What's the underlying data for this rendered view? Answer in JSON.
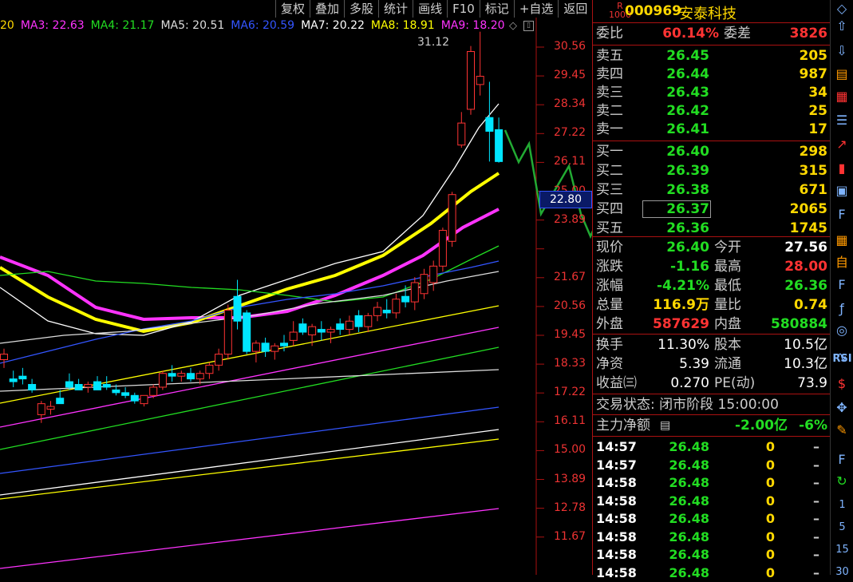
{
  "toolbar": [
    "复权",
    "叠加",
    "多股",
    "统计",
    "画线",
    "F10",
    "标记",
    "+自选",
    "返回"
  ],
  "ma_legend": [
    {
      "text": "20",
      "color": "#ffd800"
    },
    {
      "text": "MA3: 22.63",
      "color": "#ff33ff"
    },
    {
      "text": "MA4: 21.17",
      "color": "#22dd22"
    },
    {
      "text": "MA5: 20.51",
      "color": "#dddddd"
    },
    {
      "text": "MA6: 20.59",
      "color": "#3355ff"
    },
    {
      "text": "MA7: 20.22",
      "color": "#ffffff"
    },
    {
      "text": "MA8: 18.91",
      "color": "#ffff00"
    },
    {
      "text": "MA9: 18.20",
      "color": "#ff33ff"
    }
  ],
  "chart": {
    "price_ticks": [
      "30.56",
      "29.45",
      "28.34",
      "27.22",
      "26.11",
      "25.00",
      "23.89",
      "22.80",
      "21.67",
      "20.56",
      "19.45",
      "18.33",
      "17.22",
      "16.11",
      "15.00",
      "13.89",
      "12.78",
      "11.67"
    ],
    "peak_label": "31.12",
    "current_label": "22.80"
  },
  "chart_data": {
    "type": "candlestick",
    "ylim": [
      11.67,
      30.56
    ],
    "candles": [
      [
        19.2,
        19.6,
        18.9,
        19.4
      ],
      [
        18.5,
        18.8,
        18.2,
        18.4
      ],
      [
        18.6,
        18.9,
        18.3,
        18.5
      ],
      [
        18.3,
        18.5,
        18.0,
        18.1
      ],
      [
        17.2,
        17.7,
        16.9,
        17.6
      ],
      [
        17.4,
        17.7,
        17.2,
        17.5
      ],
      [
        17.8,
        18.1,
        17.6,
        17.6
      ],
      [
        18.4,
        18.7,
        18.1,
        18.2
      ],
      [
        18.3,
        18.5,
        18.1,
        18.1
      ],
      [
        18.2,
        18.4,
        18.0,
        18.3
      ],
      [
        18.4,
        18.6,
        18.1,
        18.1
      ],
      [
        18.3,
        18.6,
        18.1,
        18.2
      ],
      [
        18.1,
        18.3,
        17.9,
        18.0
      ],
      [
        18.0,
        18.2,
        17.8,
        17.9
      ],
      [
        17.9,
        18.0,
        17.6,
        17.7
      ],
      [
        17.6,
        17.9,
        17.5,
        17.9
      ],
      [
        17.9,
        18.3,
        17.8,
        18.2
      ],
      [
        18.2,
        18.8,
        18.1,
        18.7
      ],
      [
        18.7,
        19.0,
        18.4,
        18.6
      ],
      [
        18.6,
        18.8,
        18.4,
        18.7
      ],
      [
        18.7,
        18.9,
        18.4,
        18.5
      ],
      [
        18.5,
        18.8,
        18.3,
        18.7
      ],
      [
        18.7,
        19.1,
        18.5,
        19.0
      ],
      [
        19.0,
        19.6,
        18.8,
        19.4
      ],
      [
        19.4,
        21.2,
        19.2,
        21.0
      ],
      [
        21.5,
        22.1,
        20.3,
        20.6
      ],
      [
        20.9,
        21.0,
        19.4,
        19.5
      ],
      [
        19.5,
        19.9,
        19.1,
        19.8
      ],
      [
        19.8,
        20.0,
        19.3,
        19.5
      ],
      [
        19.5,
        19.8,
        19.2,
        19.7
      ],
      [
        19.8,
        20.1,
        19.5,
        19.7
      ],
      [
        19.9,
        20.6,
        19.7,
        20.2
      ],
      [
        20.5,
        20.7,
        20.1,
        20.2
      ],
      [
        20.1,
        20.5,
        19.7,
        20.4
      ],
      [
        20.3,
        20.6,
        19.9,
        20.2
      ],
      [
        20.2,
        20.4,
        19.8,
        20.3
      ],
      [
        20.5,
        20.7,
        20.1,
        20.3
      ],
      [
        20.3,
        20.8,
        20.1,
        20.6
      ],
      [
        20.8,
        21.0,
        20.2,
        20.4
      ],
      [
        20.4,
        20.9,
        20.2,
        20.8
      ],
      [
        20.8,
        21.3,
        20.6,
        21.1
      ],
      [
        21.0,
        21.4,
        20.7,
        20.9
      ],
      [
        20.9,
        21.6,
        20.7,
        21.4
      ],
      [
        21.5,
        21.9,
        21.1,
        21.3
      ],
      [
        21.3,
        22.2,
        21.0,
        22.0
      ],
      [
        21.6,
        22.5,
        21.4,
        22.3
      ],
      [
        22.0,
        22.8,
        21.7,
        22.6
      ],
      [
        22.6,
        24.0,
        22.4,
        23.9
      ],
      [
        23.5,
        25.3,
        23.3,
        25.2
      ],
      [
        27.0,
        28.2,
        26.9,
        27.8
      ],
      [
        28.3,
        30.6,
        28.1,
        30.4
      ],
      [
        29.2,
        31.12,
        28.8,
        29.5
      ],
      [
        28.0,
        29.3,
        26.4,
        27.5
      ],
      [
        27.56,
        28.0,
        26.36,
        26.4
      ]
    ]
  },
  "stock": {
    "badge_top": "R",
    "badge_bottom": "1000",
    "code": "000969",
    "name": "安泰科技"
  },
  "quote": {
    "weibi_label": "委比",
    "weibi": "60.14%",
    "weicha_label": "委差",
    "weicha": "3826",
    "asks": [
      {
        "label": "卖五",
        "price": "26.45",
        "vol": "205"
      },
      {
        "label": "卖四",
        "price": "26.44",
        "vol": "987"
      },
      {
        "label": "卖三",
        "price": "26.43",
        "vol": "34"
      },
      {
        "label": "卖二",
        "price": "26.42",
        "vol": "25"
      },
      {
        "label": "卖一",
        "price": "26.41",
        "vol": "17"
      }
    ],
    "bids": [
      {
        "label": "买一",
        "price": "26.40",
        "vol": "298"
      },
      {
        "label": "买二",
        "price": "26.39",
        "vol": "315"
      },
      {
        "label": "买三",
        "price": "26.38",
        "vol": "671"
      },
      {
        "label": "买四",
        "price": "26.37",
        "vol": "2065"
      },
      {
        "label": "买五",
        "price": "26.36",
        "vol": "1745"
      }
    ],
    "stats": [
      {
        "l1": "现价",
        "v1": "26.40",
        "c1": "g",
        "l2": "今开",
        "v2": "27.56",
        "c2": "w"
      },
      {
        "l1": "涨跌",
        "v1": "-1.16",
        "c1": "g",
        "l2": "最高",
        "v2": "28.00",
        "c2": "r"
      },
      {
        "l1": "涨幅",
        "v1": "-4.21%",
        "c1": "g",
        "l2": "最低",
        "v2": "26.36",
        "c2": "g"
      },
      {
        "l1": "总量",
        "v1": "116.9万",
        "c1": "y",
        "l2": "量比",
        "v2": "0.74",
        "c2": "y"
      },
      {
        "l1": "外盘",
        "v1": "587629",
        "c1": "r",
        "l2": "内盘",
        "v2": "580884",
        "c2": "g"
      }
    ],
    "fund": [
      {
        "l1": "换手",
        "v1": "11.30%",
        "l2": "股本",
        "v2": "10.5亿"
      },
      {
        "l1": "净资",
        "v1": "5.39",
        "l2": "流通",
        "v2": "10.3亿"
      },
      {
        "l1": "收益㈢",
        "v1": "0.270",
        "l2": "PE(动)",
        "v2": "73.9"
      }
    ],
    "trade_status": "交易状态: 闭市阶段 15:00:00",
    "main_flow_label": "主力净额",
    "main_flow": "-2.00亿",
    "main_flow_pct": "-6%"
  },
  "ticks": [
    {
      "time": "14:57",
      "price": "26.48",
      "vol": "0",
      "dir": "–"
    },
    {
      "time": "14:57",
      "price": "26.48",
      "vol": "0",
      "dir": "–"
    },
    {
      "time": "14:58",
      "price": "26.48",
      "vol": "0",
      "dir": "–"
    },
    {
      "time": "14:58",
      "price": "26.48",
      "vol": "0",
      "dir": "–"
    },
    {
      "time": "14:58",
      "price": "26.48",
      "vol": "0",
      "dir": "–"
    },
    {
      "time": "14:58",
      "price": "26.48",
      "vol": "0",
      "dir": "–"
    },
    {
      "time": "14:58",
      "price": "26.48",
      "vol": "0",
      "dir": "–"
    },
    {
      "time": "14:58",
      "price": "26.48",
      "vol": "0",
      "dir": "–"
    }
  ],
  "sidebar": {
    "icons": [
      {
        "name": "back-icon",
        "glyph": "◇",
        "color": "#7fb4ff"
      },
      {
        "name": "up-icon",
        "glyph": "⇧",
        "color": "#7fb4ff"
      },
      {
        "name": "down-icon",
        "glyph": "⇩",
        "color": "#7fb4ff"
      },
      {
        "name": "report-icon",
        "glyph": "▤",
        "color": "#ff9900"
      },
      {
        "name": "grid-icon",
        "glyph": "▦",
        "color": "#ff3333"
      },
      {
        "name": "list-icon",
        "glyph": "☰",
        "color": "#7fb4ff"
      },
      {
        "name": "line-chart-icon",
        "glyph": "↗",
        "color": "#ff3333"
      },
      {
        "name": "kline-icon",
        "glyph": "▮",
        "color": "#ff3333"
      },
      {
        "name": "doc-icon",
        "glyph": "▣",
        "color": "#7fb4ff"
      },
      {
        "name": "f10-icon",
        "glyph": "F",
        "color": "#7fb4ff"
      },
      {
        "name": "table-icon",
        "glyph": "▦",
        "color": "#ff9900"
      },
      {
        "name": "self-icon",
        "glyph": "自",
        "color": "#ff9900"
      },
      {
        "name": "f12-icon",
        "glyph": "F",
        "color": "#7fb4ff"
      },
      {
        "name": "fx-icon",
        "glyph": "ƒ",
        "color": "#7fb4ff"
      },
      {
        "name": "circle-icon",
        "glyph": "◎",
        "color": "#7fb4ff"
      },
      {
        "name": "wave-icon",
        "glyph": "∿",
        "color": "#7fb4ff"
      },
      {
        "name": "dollar-icon",
        "glyph": "$",
        "color": "#ff3333"
      },
      {
        "name": "move-icon",
        "glyph": "✥",
        "color": "#7fb4ff"
      },
      {
        "name": "pencil-icon",
        "glyph": "✎",
        "color": "#ff9900"
      },
      {
        "name": "f5-icon",
        "glyph": "F",
        "color": "#7fb4ff"
      },
      {
        "name": "refresh-icon",
        "glyph": "↻",
        "color": "#22dd22"
      }
    ],
    "texts": [
      "RSI",
      "1",
      "5",
      "15",
      "30"
    ]
  }
}
